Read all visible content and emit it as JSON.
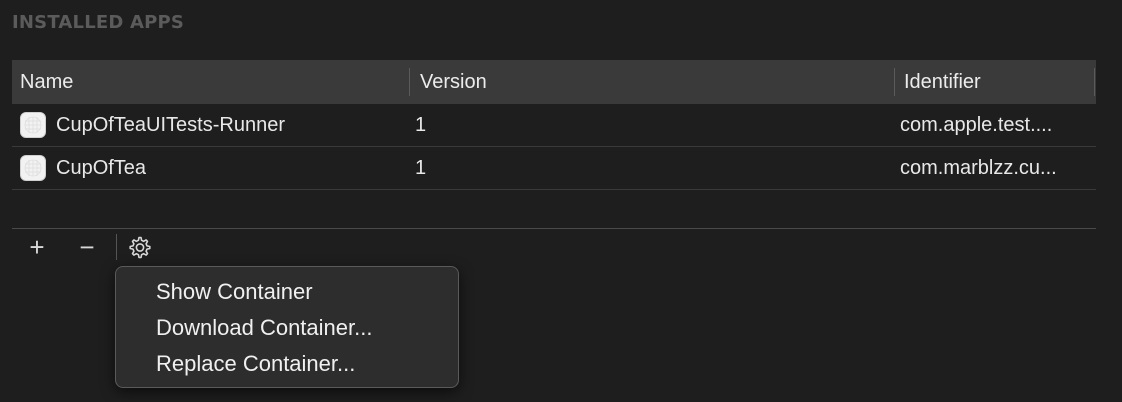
{
  "section": {
    "title": "INSTALLED APPS"
  },
  "table": {
    "columns": [
      "Name",
      "Version",
      "Identifier"
    ],
    "rows": [
      {
        "name": "CupOfTeaUITests-Runner",
        "version": "1",
        "identifier": "com.apple.test...."
      },
      {
        "name": "CupOfTea",
        "version": "1",
        "identifier": "com.marblzz.cu..."
      }
    ]
  },
  "toolbar": {
    "add_label": "+",
    "remove_label": "−",
    "gear_icon": "gear-icon"
  },
  "menu": {
    "items": [
      "Show Container",
      "Download Container...",
      "Replace Container..."
    ]
  }
}
